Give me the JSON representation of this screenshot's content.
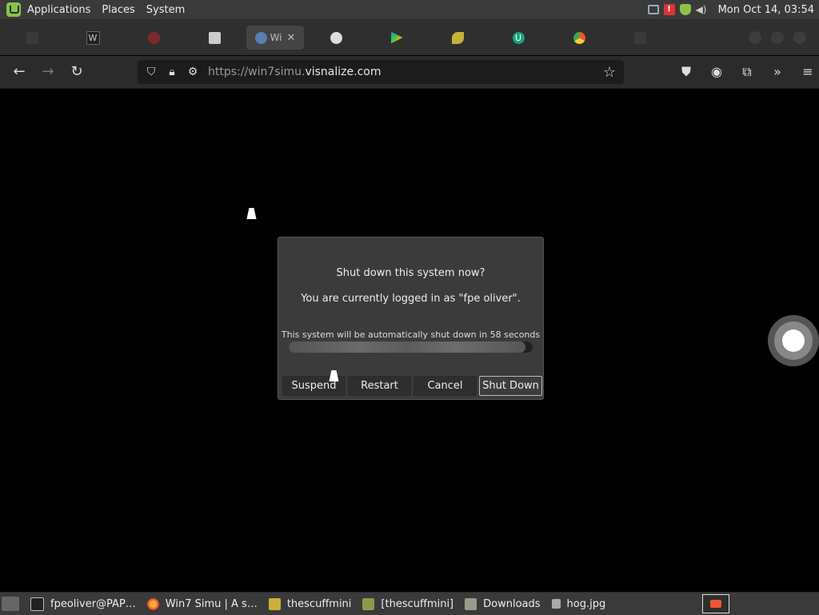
{
  "top_panel": {
    "menus": [
      "Applications",
      "Places",
      "System"
    ],
    "clock": "Mon Oct 14, 03:54",
    "tray_icons": [
      "network-icon",
      "warning-icon",
      "shield-icon",
      "volume-icon"
    ]
  },
  "browser": {
    "tabs": [
      {
        "icon": "generic-tab-icon",
        "label": ""
      },
      {
        "icon": "wikipedia-icon",
        "label": "W"
      },
      {
        "icon": "app-icon",
        "label": ""
      },
      {
        "icon": "page-icon",
        "label": ""
      },
      {
        "icon": "globe-icon",
        "label": "Wi",
        "active": true
      },
      {
        "icon": "github-icon",
        "label": ""
      },
      {
        "icon": "play-icon",
        "label": ""
      },
      {
        "icon": "leaf-icon",
        "label": ""
      },
      {
        "icon": "u-icon",
        "label": "U"
      },
      {
        "icon": "chrome-icon",
        "label": ""
      },
      {
        "icon": "tab-icon",
        "label": ""
      }
    ],
    "url_prefix": "https://win7simu.",
    "url_domain": "visnalize.com"
  },
  "dialog": {
    "title": "Shut down this system now?",
    "subtitle": "You are currently logged in as \"fpe oliver\".",
    "countdown": "This system will be automatically shut down in 58 seconds",
    "progress": 0.97,
    "buttons": {
      "suspend": "Suspend",
      "restart": "Restart",
      "cancel": "Cancel",
      "shutdown": "Shut Down"
    }
  },
  "taskbar": {
    "tasks": [
      {
        "icon": "terminal-icon",
        "label": "fpeoliver@PAP…"
      },
      {
        "icon": "firefox-icon",
        "label": "Win7 Simu | A s…"
      },
      {
        "icon": "image-icon",
        "label": "thescuffmini"
      },
      {
        "icon": "image-viewer-icon",
        "label": "[thescuffmini]"
      },
      {
        "icon": "folder-icon",
        "label": "Downloads"
      },
      {
        "icon": "file-icon",
        "label": "hog.jpg"
      }
    ]
  },
  "colors": {
    "panel_bg": "#3a3a3a",
    "dialog_bg": "#3b3b3b",
    "mint_green": "#8bc34a",
    "desktop_bg": "#000000"
  }
}
